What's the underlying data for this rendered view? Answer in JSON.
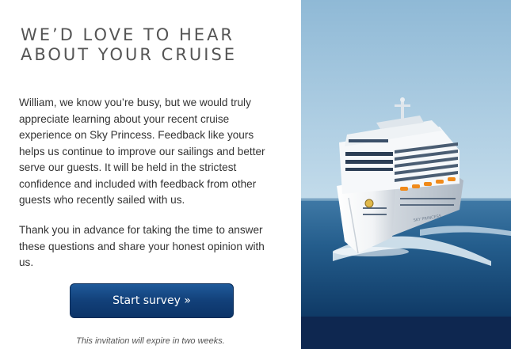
{
  "content": {
    "headline_line1": "WE’D LOVE TO HEAR",
    "headline_line2": "ABOUT YOUR CRUISE",
    "paragraph1": "William, we know you’re busy, but we would truly appreciate learning about your recent cruise experience on Sky Princess. Feedback like yours helps us continue to improve our sailings and better serve our guests. It will be held in the strictest confidence and included with feedback from other guests who recently sailed with us.",
    "paragraph2": "Thank you in advance for taking the time to answer these questions and share your honest opinion with us.",
    "button_label": "Start survey »",
    "expiry_note": "This invitation will expire in two weeks."
  },
  "colors": {
    "button_top": "#1f5a9a",
    "button_bottom": "#0c3468",
    "footer_bar": "#0e2750",
    "sky": "#cfe3ef",
    "sea": "#1f5a88"
  },
  "image": {
    "subject": "cruise-ship-at-sea",
    "ship_name": "SKY PRINCESS"
  }
}
